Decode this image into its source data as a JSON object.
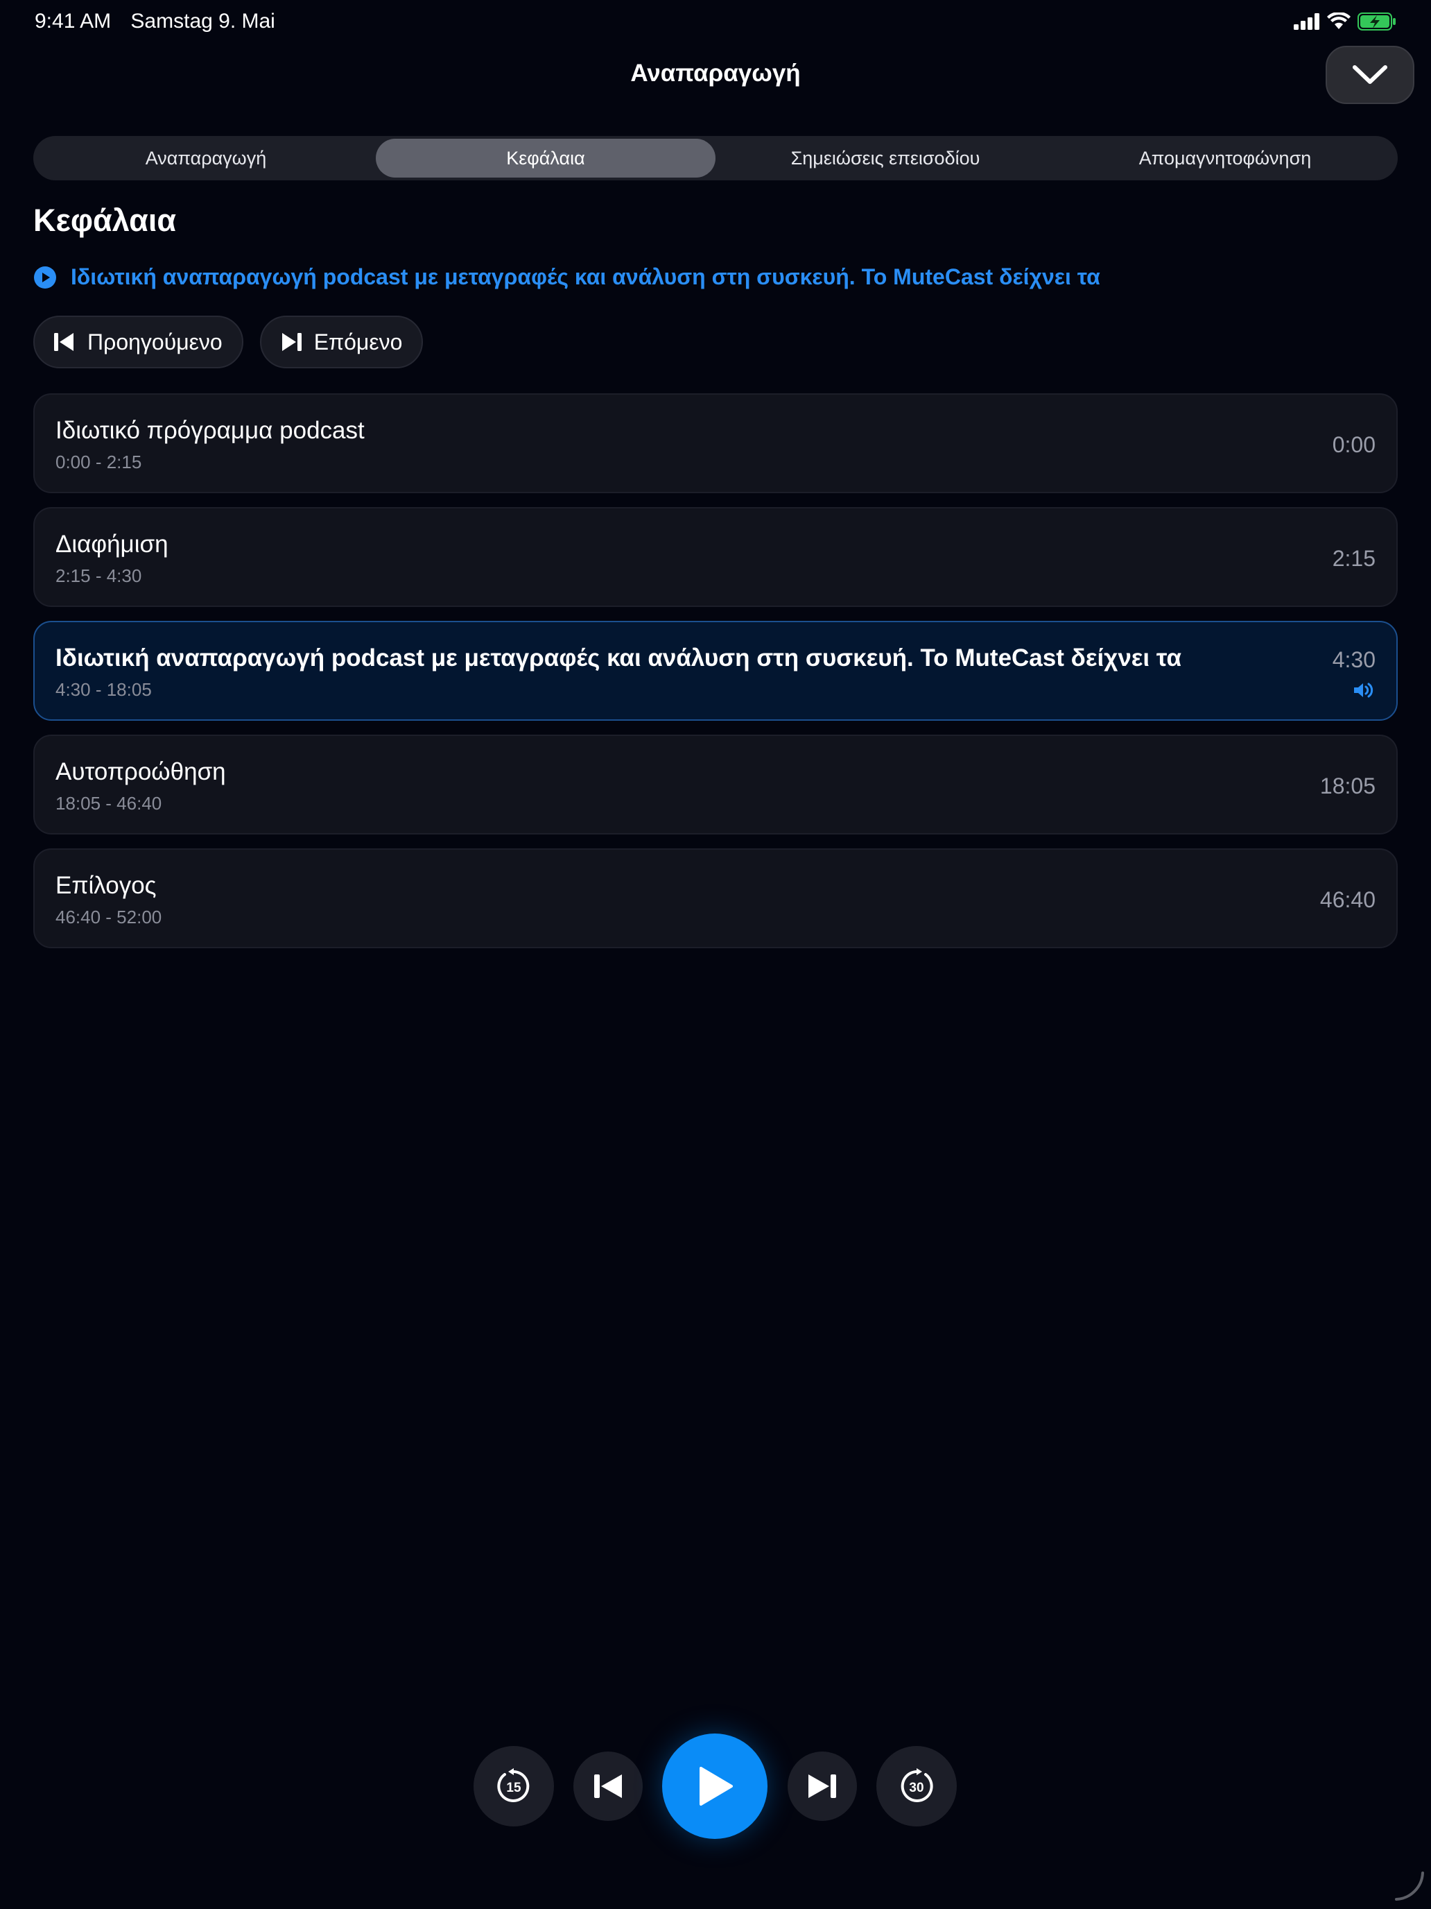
{
  "status_bar": {
    "time": "9:41 AM",
    "date": "Samstag 9. Mai"
  },
  "header": {
    "title": "Αναπαραγωγή"
  },
  "tabs": [
    {
      "label": "Αναπαραγωγή",
      "active": false
    },
    {
      "label": "Κεφάλαια",
      "active": true
    },
    {
      "label": "Σημειώσεις επεισοδίου",
      "active": false
    },
    {
      "label": "Απομαγνητοφώνηση",
      "active": false
    }
  ],
  "section": {
    "title": "Κεφάλαια",
    "now_playing": "Ιδιωτική αναπαραγωγή podcast με μεταγραφές και ανάλυση στη συσκευή. Το MuteCast δείχνει τα"
  },
  "nav": {
    "previous_label": "Προηγούμενο",
    "next_label": "Επόμενο"
  },
  "chapters": [
    {
      "title": "Ιδιωτικό πρόγραμμα podcast",
      "range": "0:00 - 2:15",
      "start": "0:00",
      "active": false
    },
    {
      "title": "Διαφήμιση",
      "range": "2:15 - 4:30",
      "start": "2:15",
      "active": false
    },
    {
      "title": "Ιδιωτική αναπαραγωγή podcast με μεταγραφές και ανάλυση στη συσκευή. Το MuteCast δείχνει τα",
      "range": "4:30 - 18:05",
      "start": "4:30",
      "active": true
    },
    {
      "title": "Αυτοπροώθηση",
      "range": "18:05 - 46:40",
      "start": "18:05",
      "active": false
    },
    {
      "title": "Επίλογος",
      "range": "46:40 - 52:00",
      "start": "46:40",
      "active": false
    }
  ],
  "player": {
    "skip_back_seconds": "15",
    "skip_forward_seconds": "30"
  },
  "colors": {
    "accent": "#0a8cf7",
    "link": "#2a8ef5",
    "background": "#03050f",
    "battery": "#34c759"
  },
  "icons": {
    "signal": "cellular-signal-icon",
    "wifi": "wifi-icon",
    "battery": "battery-charging-icon",
    "collapse": "chevron-down-icon",
    "play": "play-icon",
    "speaker": "speaker-icon"
  }
}
